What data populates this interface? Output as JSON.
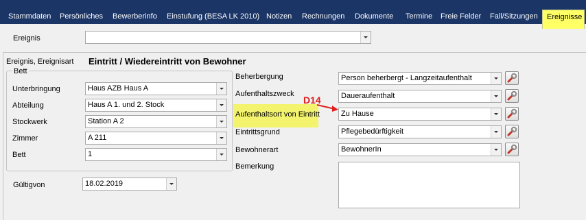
{
  "tabs": [
    {
      "label": "Stammdaten"
    },
    {
      "label": "Persönliches"
    },
    {
      "label": "Bewerberinfo"
    },
    {
      "label": "Einstufung (BESA LK 2010)"
    },
    {
      "label": "Notizen"
    },
    {
      "label": "Rechnungen"
    },
    {
      "label": "Dokumente"
    },
    {
      "label": "Termine"
    },
    {
      "label": "Freie Felder"
    },
    {
      "label": "Fall/Sitzungen"
    },
    {
      "label": "Ereignisse"
    }
  ],
  "ereignis": {
    "label": "Ereignis",
    "value": ""
  },
  "section": {
    "label": "Ereignis, Ereignisart",
    "title": "Eintritt / Wiedereintritt von Bewohner"
  },
  "bett_group": {
    "title": "Bett",
    "fields": [
      {
        "label": "Unterbringung",
        "value": "Haus AZB Haus A"
      },
      {
        "label": "Abteilung",
        "value": "Haus A 1. und 2. Stock"
      },
      {
        "label": "Stockwerk",
        "value": "Station A 2"
      },
      {
        "label": "Zimmer",
        "value": "A 211"
      },
      {
        "label": "Bett",
        "value": "1"
      }
    ]
  },
  "gueltig": {
    "label": "Gültigvon",
    "value": "18.02.2019"
  },
  "right_fields": [
    {
      "label": "Beherbergung",
      "value": "Person beherbergt - Langzeitaufenthalt"
    },
    {
      "label": "Aufenthaltszweck",
      "value": "Daueraufenthalt"
    },
    {
      "label": "Aufenthaltsort von Eintritt",
      "value": "Zu Hause"
    },
    {
      "label": "Eintrittsgrund",
      "value": "Pflegebedürftigkeit"
    },
    {
      "label": "Bewohnerart",
      "value": "BewohnerIn"
    }
  ],
  "bemerkung": {
    "label": "Bemerkung",
    "value": ""
  },
  "annotation": {
    "text": "D14",
    "color": "#e02020"
  },
  "colors": {
    "tabbar": "#1a3566",
    "highlight": "#f3f36d",
    "active_tab": "#ffff66"
  },
  "icons": {
    "tool_button": "wrench-icon",
    "dropdown": "chevron-down-icon"
  }
}
